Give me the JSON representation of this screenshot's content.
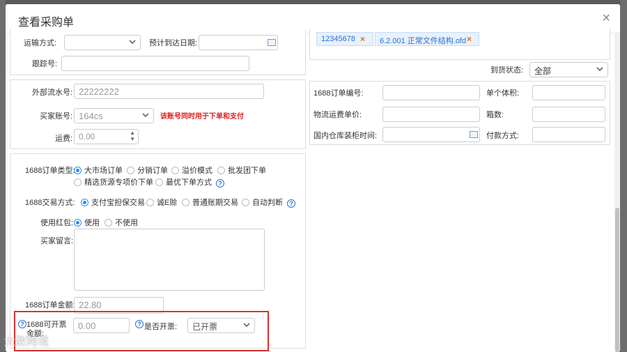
{
  "modal": {
    "title": "查看采购单",
    "close_icon": "×"
  },
  "shipping": {
    "transport_label": "运输方式:",
    "eta_label": "预计到达日期:",
    "tracking_label": "跟踪号:"
  },
  "attachments": [
    {
      "name": "12345678"
    },
    {
      "name": "6.2.001 正常文件结构.ofd"
    }
  ],
  "arrival": {
    "label": "到货状态:",
    "value": "全部"
  },
  "right_form": {
    "order_no_label": "1688订单编号:",
    "unit_volume_label": "单个体积:",
    "freight_price_label": "物流运费单价:",
    "boxes_label": "箱数:",
    "warehouse_time_label": "国内仓库装柜时间:",
    "payment_label": "付款方式:"
  },
  "payment_info": {
    "ext_serial_label": "外部流水号:",
    "ext_serial_value": "22222222",
    "buyer_account_label": "买家账号:",
    "buyer_account_value": "164cs",
    "buyer_account_warning": "该账号同时用于下单和支付",
    "freight_label": "运费:",
    "freight_value": "0.00"
  },
  "order_options": {
    "order_type_label": "1688订单类型:",
    "order_types": [
      "大市场订单",
      "分销订单",
      "溢价模式",
      "批发团下单",
      "精选货源专项价下单",
      "最优下单方式"
    ],
    "order_type_selected": 0,
    "trade_label": "1688交易方式:",
    "trade_modes": [
      "支付宝担保交易",
      "诚E赊",
      "普通账期交易",
      "自动判断"
    ],
    "trade_selected": 0,
    "redpack_label": "使用红包:",
    "redpack_options": [
      "使用",
      "不使用"
    ],
    "redpack_selected": 0,
    "buyer_note_label": "买家留言:",
    "order_amount_label": "1688订单金额:",
    "order_amount_value": "22.80"
  },
  "invoice": {
    "amount_label": "1688可开票金额:",
    "amount_value": "0.00",
    "status_label": "是否开票:",
    "status_value": "已开票"
  },
  "watermark": "大数跨境"
}
